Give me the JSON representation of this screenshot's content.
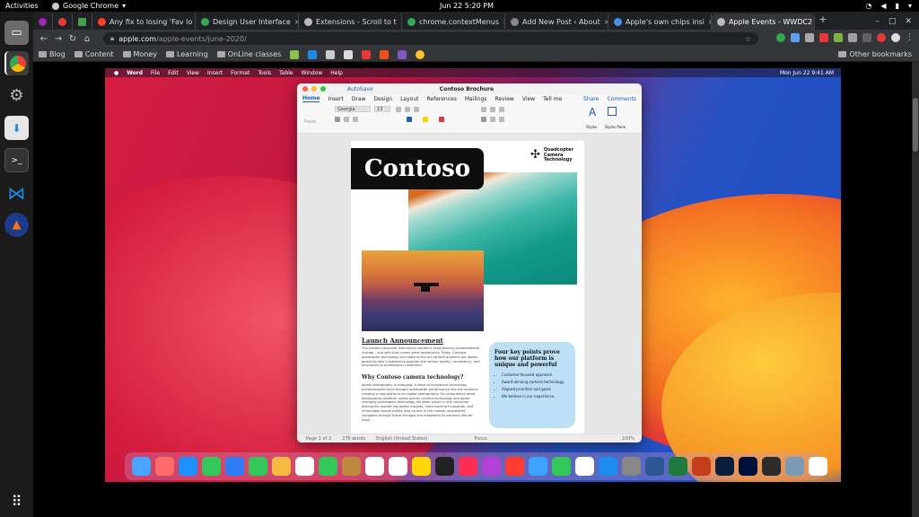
{
  "topbar": {
    "activities": "Activities",
    "app": "Google Chrome",
    "clock": "Jun 22  5:20 PM"
  },
  "tabs": [
    {
      "title": "Any fix to losing 'Fav lo",
      "color": "#ff3b30"
    },
    {
      "title": "Design User Interface",
      "color": "#34a853"
    },
    {
      "title": "Extensions - Scroll to t",
      "color": "#bbbbbb"
    },
    {
      "title": "chrome.contextMenus",
      "color": "#34a853"
    },
    {
      "title": "Add New Post ‹ About",
      "color": "#888888"
    },
    {
      "title": "Apple's own chips insi",
      "color": "#4a90e2"
    },
    {
      "title": "Apple Events - WWDC2",
      "color": "#bbbbbb"
    }
  ],
  "address": {
    "host": "apple.com",
    "path": "/apple-events/june-2020/"
  },
  "bookmarks": [
    "Blog",
    "Content",
    "Money",
    "Learning",
    "OnLine classes"
  ],
  "other_bookmarks": "Other bookmarks",
  "mac_menu": {
    "items": [
      "Word",
      "File",
      "Edit",
      "View",
      "Insert",
      "Format",
      "Tools",
      "Table",
      "Window",
      "Help"
    ],
    "clock": "Mon Jun 22  9:41 AM"
  },
  "word": {
    "autosave": "AutoSave",
    "doc_title": "Contoso Brochure",
    "tabs": [
      "Home",
      "Insert",
      "Draw",
      "Design",
      "Layout",
      "References",
      "Mailings",
      "Review",
      "View"
    ],
    "tell_me": "Tell me",
    "share": "Share",
    "comments": "Comments",
    "font": "Georgia",
    "font_size": "13",
    "paste": "Paste",
    "styles": "Styles",
    "styles_pane": "Styles Pane",
    "heading": "Contoso",
    "logo_text": "Quadcopter Camera Technology",
    "launch": "Launch Announcement",
    "launch_text": "The current consumer electronics market is experiencing unprecedented change – and with that comes great opportunity. Today, Contoso quadcopter technology and state-of-the-art camera products are ideally poised to take a leadership position and deliver quality, consistency, and innovation to professional customers.",
    "why": "Why Contoso camera technology?",
    "why_text": "Aerial photography is changing. A wave of innovative technology enhancements have brought quadcopter performance into the moment, creating a new platform for digital photography. Our proprietary aerial photography platform unites proven camera technology and game changing quadcopter technology. No other player in the consumer electronics market has better insights, more exciting innovation, and remarkable brand loyalty. And no one in the market consistently navigates through these changes and empowers its partners like we have.",
    "kp_title": "Four key points prove how our platform is unique and powerful",
    "kp_items": [
      "Customer-focused approach.",
      "Award-winning camera technology.",
      "Aligned priorities and goals.",
      "We believe in our experience."
    ],
    "status": {
      "page": "Page 1 of 2",
      "words": "276 words",
      "lang": "English (United States)",
      "focus": "Focus",
      "zoom": "100%"
    }
  },
  "mac_dock_colors": [
    "#4aa3ff",
    "#ff6b6b",
    "#1e90ff",
    "#34c759",
    "#2f7cf6",
    "#34c759",
    "#f5b942",
    "#ffffff",
    "#34c759",
    "#c08a3e",
    "#ffffff",
    "#ffffff",
    "#ffd60a",
    "#222222",
    "#ff2d55",
    "#b341d9",
    "#ff3b30",
    "#3ea0ff",
    "#34c759",
    "#ffffff",
    "#1c8cf0",
    "#888888",
    "#2b5797",
    "#1f7a3d",
    "#c43e1c",
    "#0a1f3d",
    "#00103d",
    "#2c2c2c",
    "#7a9ab5",
    "#ffffff"
  ]
}
